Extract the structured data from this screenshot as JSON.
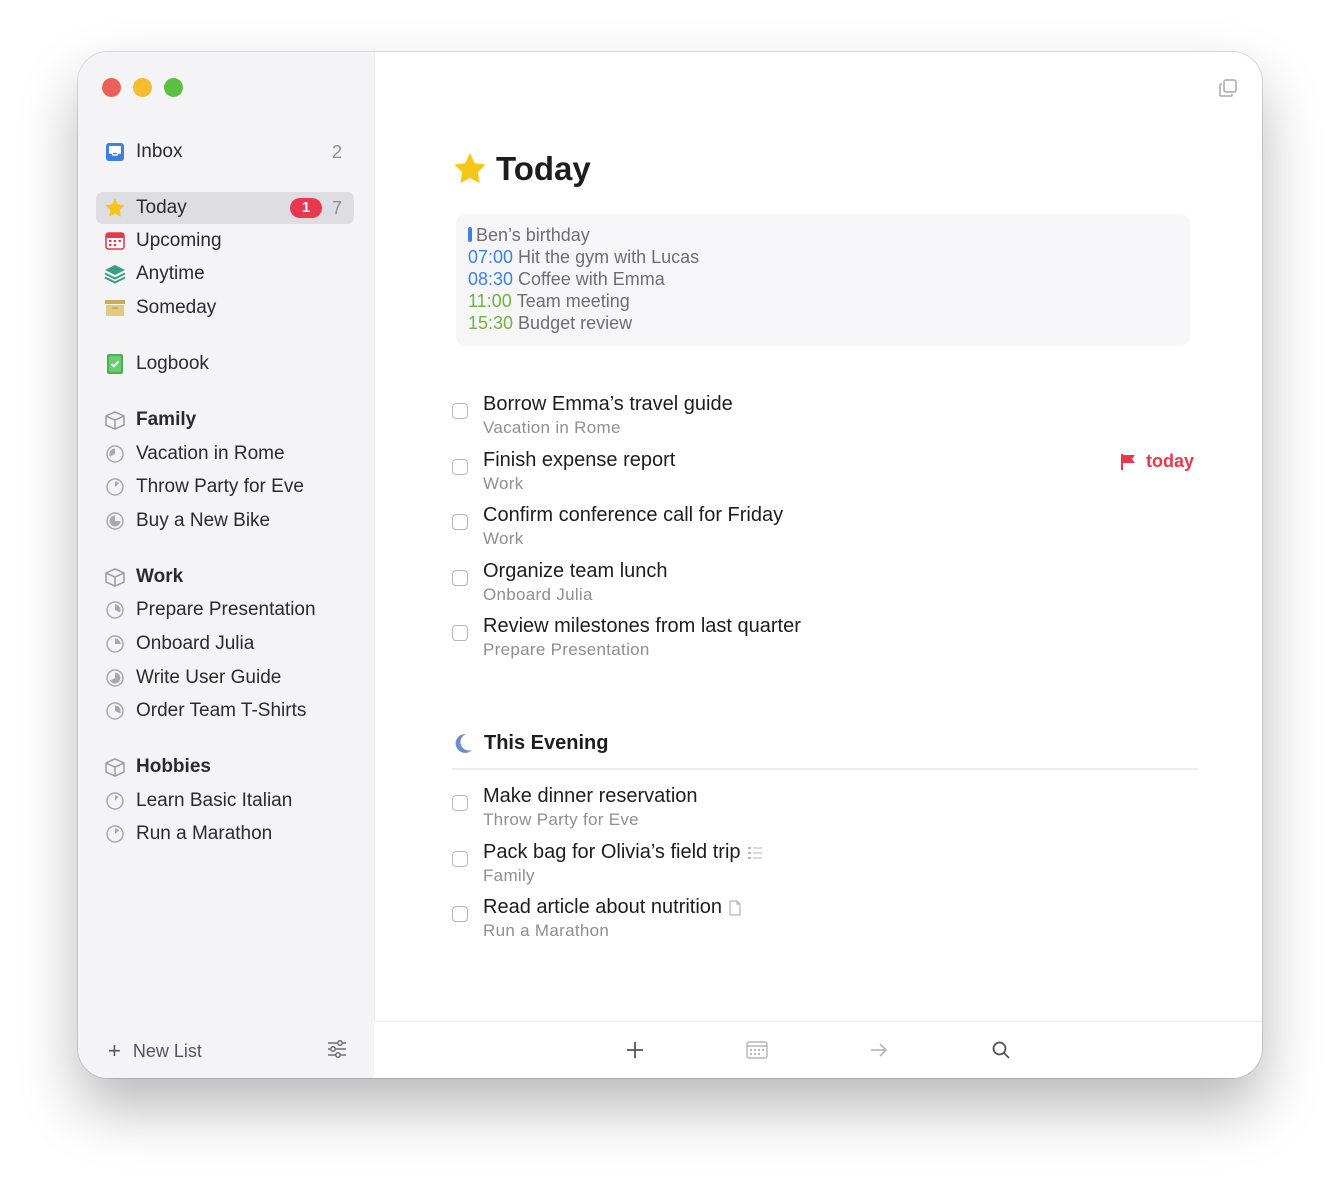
{
  "sidebar": {
    "inbox": {
      "label": "Inbox",
      "count": "2"
    },
    "today": {
      "label": "Today",
      "badge": "1",
      "count": "7"
    },
    "upcoming": {
      "label": "Upcoming"
    },
    "anytime": {
      "label": "Anytime"
    },
    "someday": {
      "label": "Someday"
    },
    "logbook": {
      "label": "Logbook"
    },
    "areas": [
      {
        "label": "Family",
        "projects": [
          "Vacation in Rome",
          "Throw Party for Eve",
          "Buy a New Bike"
        ]
      },
      {
        "label": "Work",
        "projects": [
          "Prepare Presentation",
          "Onboard Julia",
          "Write User Guide",
          "Order Team T-Shirts"
        ]
      },
      {
        "label": "Hobbies",
        "projects": [
          "Learn Basic Italian",
          "Run a Marathon"
        ]
      }
    ],
    "footer": {
      "new_list": "New List"
    }
  },
  "main": {
    "title": "Today",
    "calendar": {
      "allday": "Ben’s birthday",
      "events": [
        {
          "time": "07:00",
          "title": "Hit the gym with Lucas",
          "color": "#3d80e0"
        },
        {
          "time": "08:30",
          "title": "Coffee with Emma",
          "color": "#3d80e0"
        },
        {
          "time": "11:00",
          "title": "Team meeting",
          "color": "#6fb33f"
        },
        {
          "time": "15:30",
          "title": "Budget review",
          "color": "#6fb33f"
        }
      ]
    },
    "tasks": [
      {
        "title": "Borrow Emma’s travel guide",
        "project": "Vacation in Rome"
      },
      {
        "title": "Finish expense report",
        "project": "Work",
        "deadline": "today"
      },
      {
        "title": "Confirm conference call for Friday",
        "project": "Work"
      },
      {
        "title": "Organize team lunch",
        "project": "Onboard Julia"
      },
      {
        "title": "Review milestones from last quarter",
        "project": "Prepare Presentation"
      }
    ],
    "evening": {
      "title": "This Evening",
      "tasks": [
        {
          "title": "Make dinner reservation",
          "project": "Throw Party for Eve"
        },
        {
          "title": "Pack bag for Olivia’s field trip",
          "project": "Family",
          "icon": "checklist-icon"
        },
        {
          "title": "Read article about nutrition",
          "project": "Run a Marathon",
          "icon": "note-icon"
        }
      ]
    }
  },
  "colors": {
    "accent_red": "#e8384f",
    "today_star": "#f5c518",
    "inbox_blue": "#3d80e0"
  }
}
